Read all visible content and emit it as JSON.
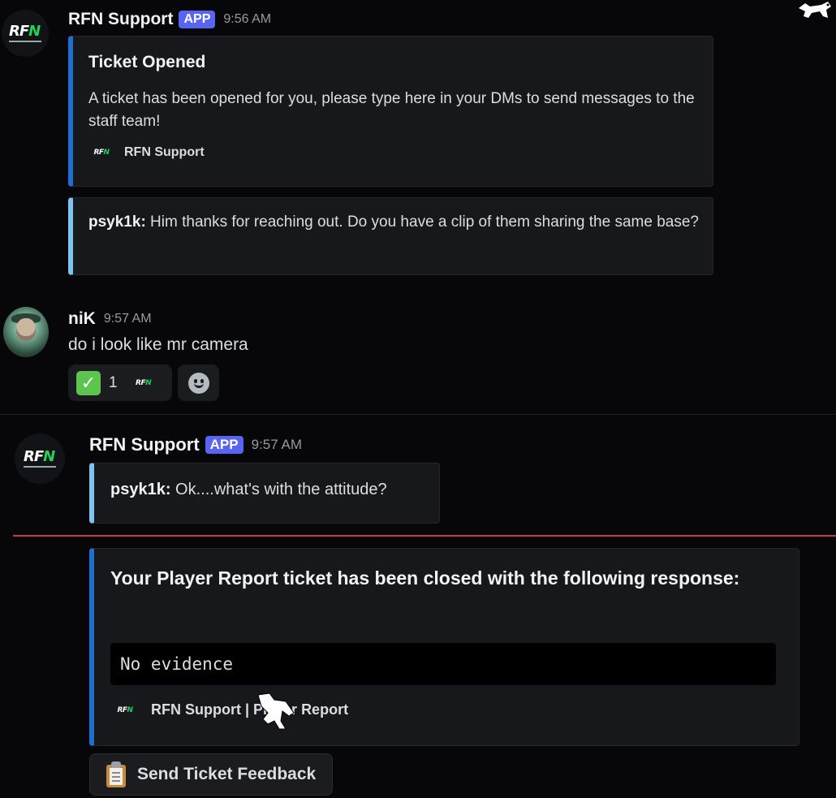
{
  "messages": [
    {
      "author": "RFN Support",
      "badge": "APP",
      "time": "9:56 AM",
      "embed": {
        "title": "Ticket Opened",
        "description": "A ticket has been opened for you, please type here in your DMs to send messages to the staff team!",
        "footer": "RFN Support"
      },
      "quote": {
        "speaker": "psyk1k:",
        "text": " Him thanks for reaching out. Do you have a clip of them sharing the same base?"
      }
    },
    {
      "author": "niK",
      "time": "9:57 AM",
      "text": "do i look like mr camera",
      "reaction": {
        "emoji": "✓",
        "count": "1"
      }
    },
    {
      "author": "RFN Support",
      "badge": "APP",
      "time": "9:57 AM",
      "quote": {
        "speaker": "psyk1k:",
        "text": " Ok....what's with the attitude?"
      },
      "embed": {
        "title": "Your Player Report ticket has been closed with the following response:",
        "code": "No evidence",
        "footer": "RFN Support | Player Report"
      },
      "button": {
        "label": "Send Ticket Feedback",
        "icon": "clipboard-icon"
      }
    }
  ],
  "logo": {
    "left": "RF",
    "accent": "N"
  },
  "colors": {
    "background": "#070709",
    "embed_bg": "#17181b",
    "embed_accent": "#1f6fd0",
    "quote_accent": "#7ec5ed",
    "badge": "#5865f2",
    "new_messages_line": "#c43a44",
    "reaction_check": "#5cc54c"
  }
}
